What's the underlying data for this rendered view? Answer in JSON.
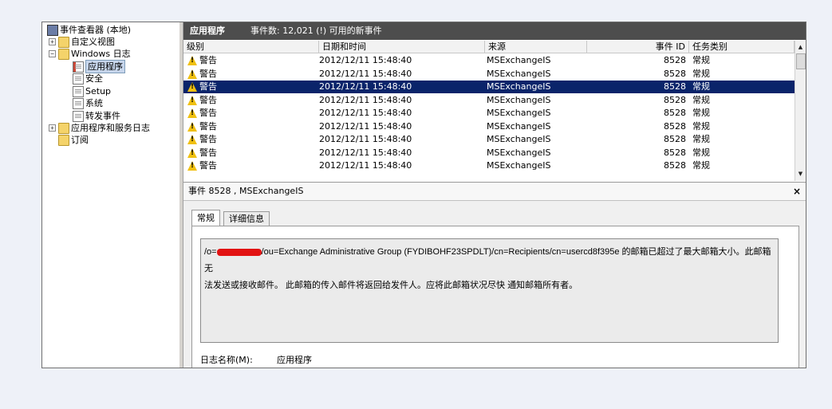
{
  "tree": {
    "items": [
      {
        "label": "事件查看器 (本地)",
        "expander": "",
        "icon": "event-viewer-icon"
      },
      {
        "label": "自定义视图",
        "expander": "+",
        "icon": "folder-icon"
      },
      {
        "label": "Windows 日志",
        "expander": "−",
        "icon": "folder-icon"
      },
      {
        "label": "应用程序",
        "expander": "",
        "icon": "log-icon"
      },
      {
        "label": "安全",
        "expander": "",
        "icon": "log-icon"
      },
      {
        "label": "Setup",
        "expander": "",
        "icon": "log-icon"
      },
      {
        "label": "系统",
        "expander": "",
        "icon": "log-icon"
      },
      {
        "label": "转发事件",
        "expander": "",
        "icon": "log-icon"
      },
      {
        "label": "应用程序和服务日志",
        "expander": "+",
        "icon": "folder-icon"
      },
      {
        "label": "订阅",
        "expander": "",
        "icon": "folder-icon"
      }
    ],
    "selected_index": 3
  },
  "header": {
    "title": "应用程序",
    "summary": "事件数: 12,021 (!) 可用的新事件"
  },
  "grid": {
    "columns": [
      "级别",
      "日期和时间",
      "来源",
      "事件 ID",
      "任务类别"
    ],
    "rows": [
      {
        "level": "警告",
        "datetime": "2012/12/11 15:48:40",
        "source": "MSExchangeIS",
        "event_id": "8528",
        "category": "常规"
      },
      {
        "level": "警告",
        "datetime": "2012/12/11 15:48:40",
        "source": "MSExchangeIS",
        "event_id": "8528",
        "category": "常规"
      },
      {
        "level": "警告",
        "datetime": "2012/12/11 15:48:40",
        "source": "MSExchangeIS",
        "event_id": "8528",
        "category": "常规"
      },
      {
        "level": "警告",
        "datetime": "2012/12/11 15:48:40",
        "source": "MSExchangeIS",
        "event_id": "8528",
        "category": "常规"
      },
      {
        "level": "警告",
        "datetime": "2012/12/11 15:48:40",
        "source": "MSExchangeIS",
        "event_id": "8528",
        "category": "常规"
      },
      {
        "level": "警告",
        "datetime": "2012/12/11 15:48:40",
        "source": "MSExchangeIS",
        "event_id": "8528",
        "category": "常规"
      },
      {
        "level": "警告",
        "datetime": "2012/12/11 15:48:40",
        "source": "MSExchangeIS",
        "event_id": "8528",
        "category": "常规"
      },
      {
        "level": "警告",
        "datetime": "2012/12/11 15:48:40",
        "source": "MSExchangeIS",
        "event_id": "8528",
        "category": "常规"
      },
      {
        "level": "警告",
        "datetime": "2012/12/11 15:48:40",
        "source": "MSExchangeIS",
        "event_id": "8528",
        "category": "常规"
      }
    ],
    "selected_row": 2
  },
  "detail": {
    "title": "事件 8528 , MSExchangeIS",
    "close": "×",
    "tabs": [
      "常规",
      "详细信息"
    ],
    "active_tab": 0,
    "message_prefix": "/o=",
    "message_line1_rest": "/ou=Exchange Administrative Group (FYDIBOHF23SPDLT)/cn=Recipients/cn=usercd8f395e 的邮箱已超过了最大邮箱大小。此邮箱无",
    "message_line2": "法发送或接收邮件。 此邮箱的传入邮件将返回给发件人。应将此邮箱状况尽快 通知邮箱所有者。",
    "log_name_label": "日志名称(M):",
    "log_name_value": "应用程序"
  },
  "colors": {
    "titlebar": "#4d4d4d",
    "selection": "#0a246a",
    "warning": "#f0c010",
    "redaction": "#e21212"
  }
}
